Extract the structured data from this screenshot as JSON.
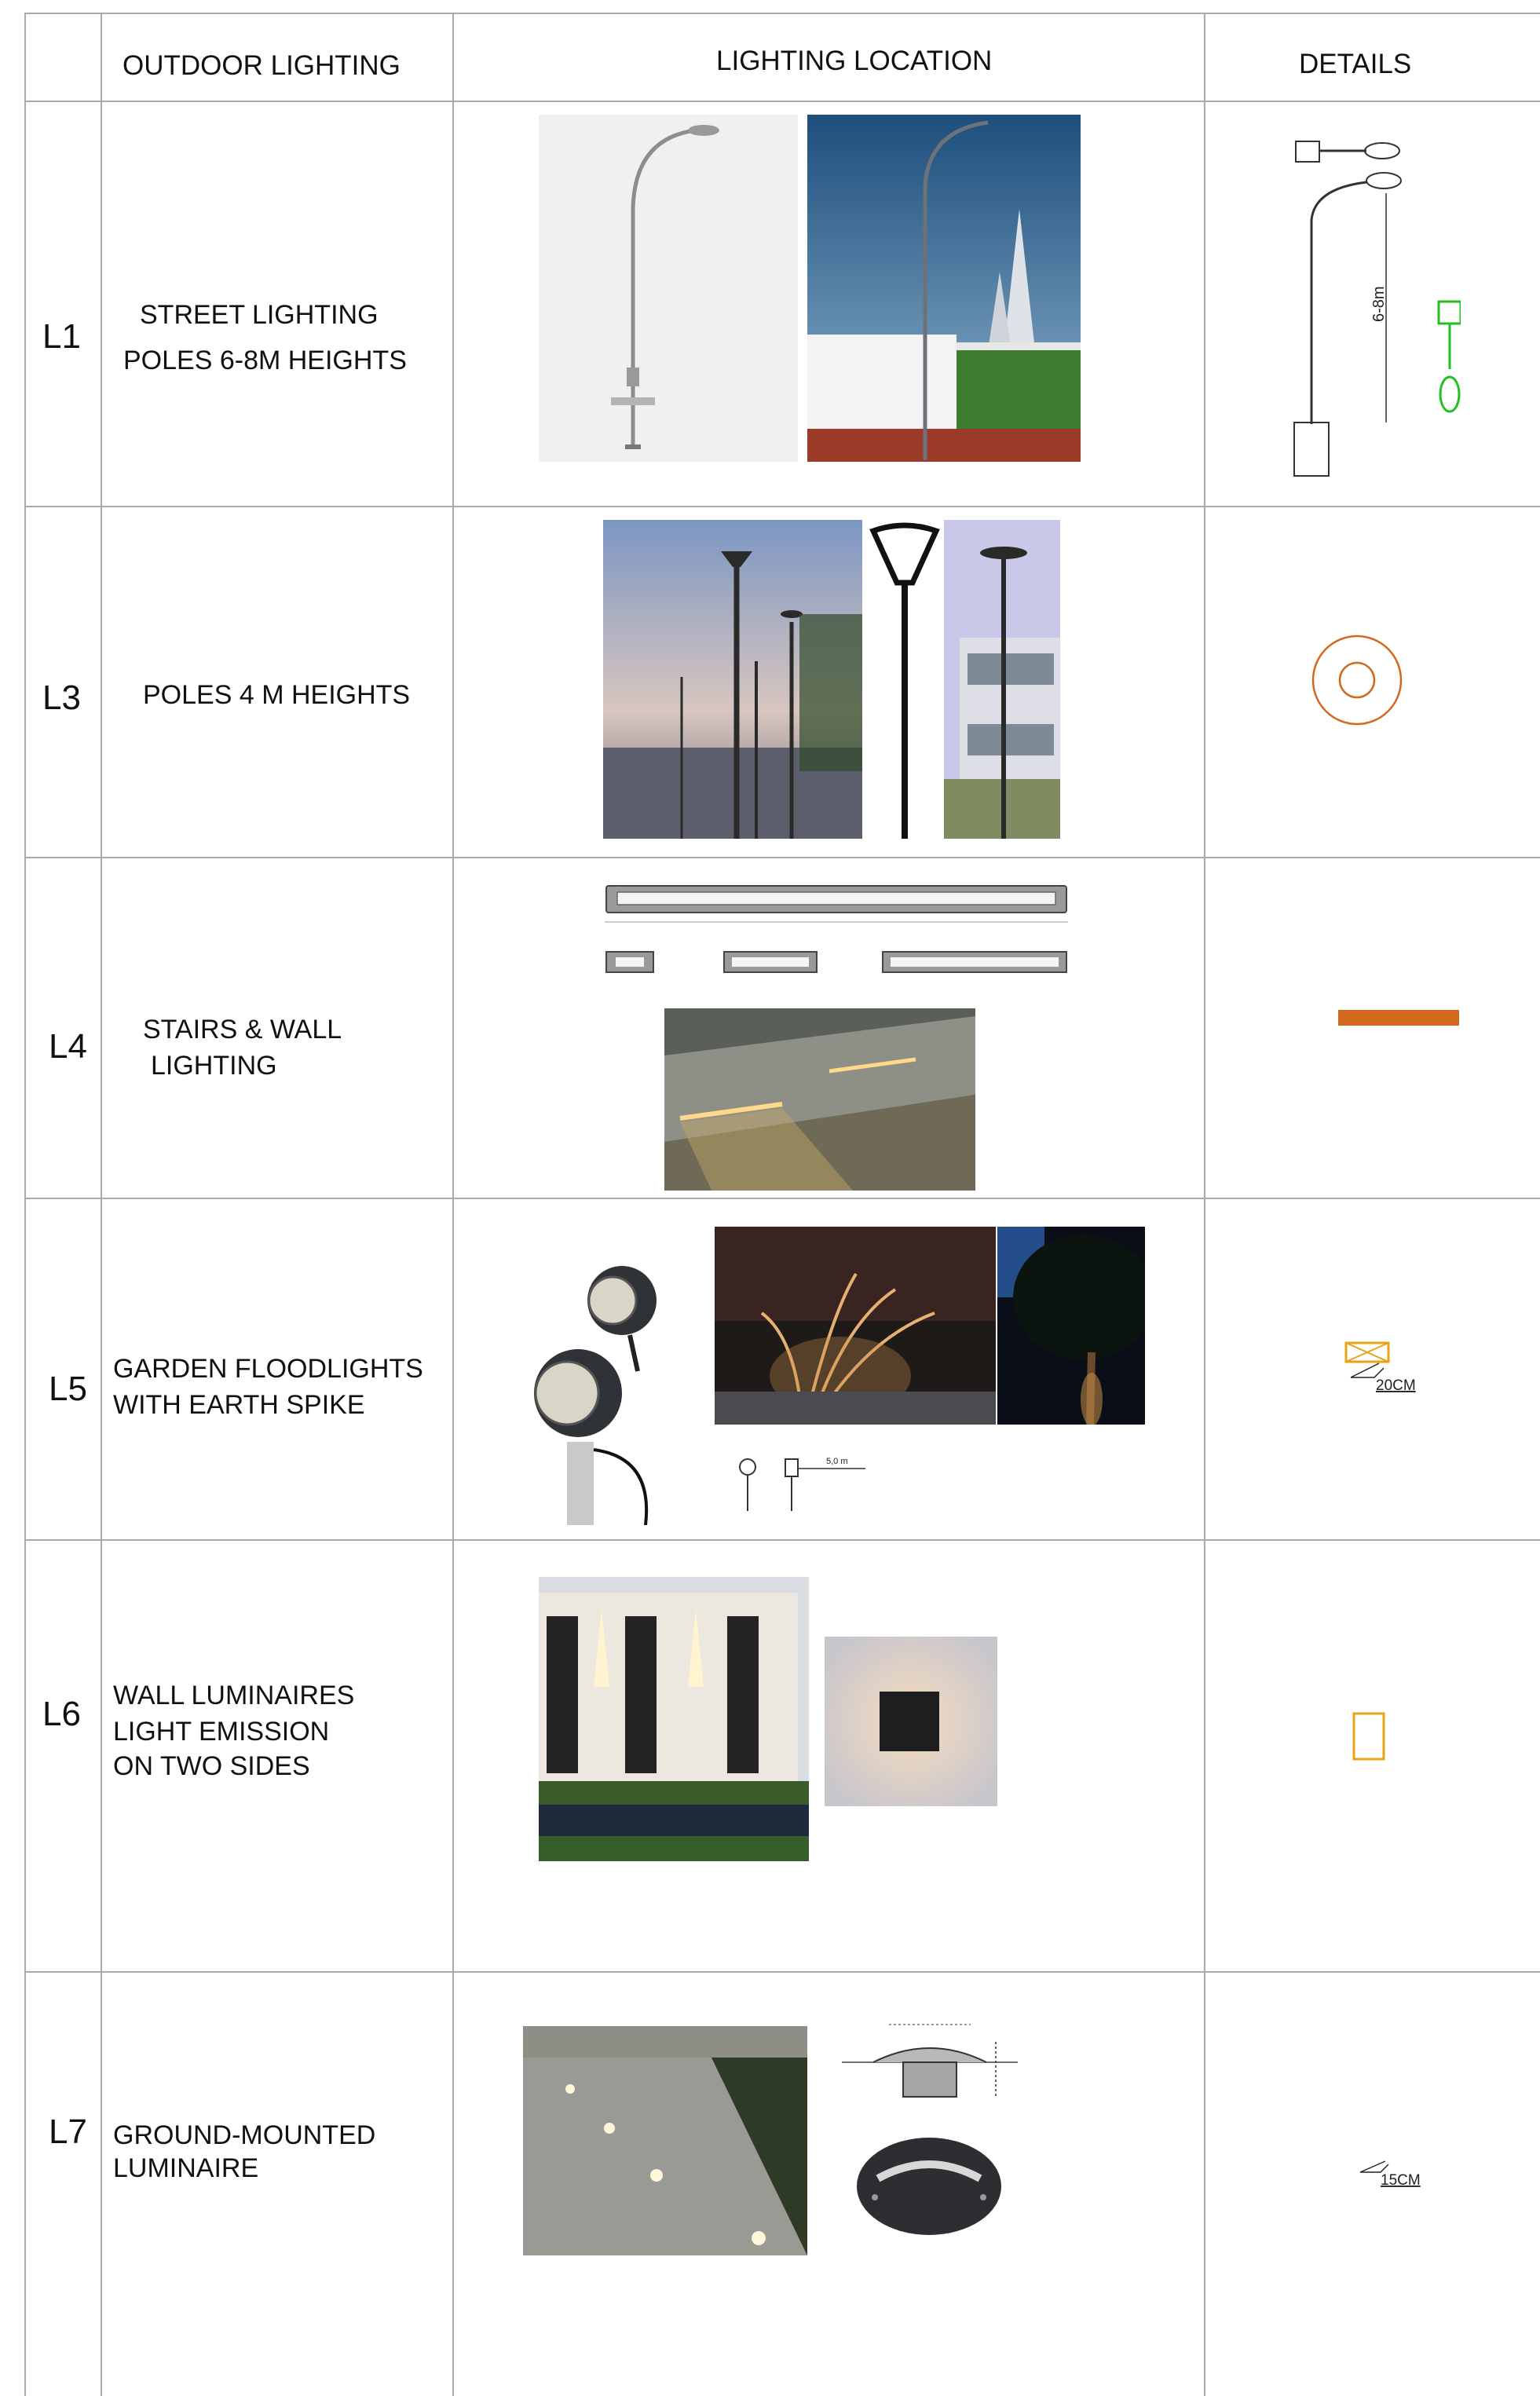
{
  "headers": {
    "c1": "OUTDOOR LIGHTING",
    "c2": "LIGHTING LOCATION",
    "c3": "DETAILS"
  },
  "rows": [
    {
      "code": "L1",
      "desc": [
        "STREET LIGHTING",
        "POLES 6-8M HEIGHTS"
      ],
      "detail": "6-8m"
    },
    {
      "code": "L3",
      "desc": [
        "POLES 4 M HEIGHTS"
      ]
    },
    {
      "code": "L4",
      "desc": [
        "STAIRS & WALL",
        "LIGHTING"
      ]
    },
    {
      "code": "L5",
      "desc": [
        "GARDEN FLOODLIGHTS",
        "WITH EARTH SPIKE"
      ],
      "detail": "20CM",
      "dim": "5,0 m"
    },
    {
      "code": "L6",
      "desc": [
        "WALL LUMINAIRES",
        "LIGHT EMISSION",
        "ON TWO SIDES"
      ]
    },
    {
      "code": "L7",
      "desc": [
        "GROUND-MOUNTED",
        "LUMINAIRE"
      ],
      "detail": "15CM"
    }
  ],
  "colors": {
    "grid": "#a9a9a9",
    "accent": "#d2691e",
    "green": "#22c022",
    "yellow": "#e8a317"
  }
}
